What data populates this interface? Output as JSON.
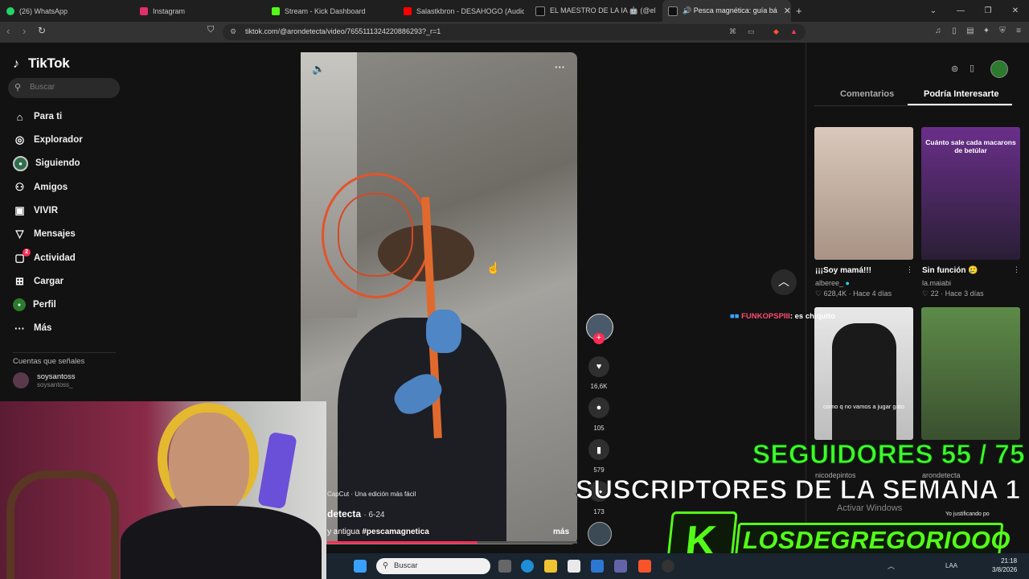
{
  "browser": {
    "tabs": [
      {
        "label": "(26) WhatsApp",
        "color": "#25d366"
      },
      {
        "label": "Instagram",
        "color": "#e1306c"
      },
      {
        "label": "Stream - Kick Dashboard",
        "color": "#53fc18"
      },
      {
        "label": "Salastkbron - DESAHOGO (Audio Ofi",
        "color": "#ff0000"
      },
      {
        "label": "EL MAESTRO DE LA IA 🤖 (@elmaest",
        "color": "#ffffff"
      },
      {
        "label": "🔊 Pesca magnética: guía básica",
        "color": "#ffffff"
      }
    ],
    "new_tab": "+",
    "url": "tiktok.com/@arondetecta/video/7655111324220886293?_r=1"
  },
  "tiktok": {
    "logo": "TikTok",
    "search_placeholder": "Buscar",
    "nav": [
      {
        "label": "Para ti",
        "icon": "home-icon"
      },
      {
        "label": "Explorador",
        "icon": "compass-icon"
      },
      {
        "label": "Siguiendo",
        "icon": "following-icon"
      },
      {
        "label": "Amigos",
        "icon": "friends-icon"
      },
      {
        "label": "VIVIR",
        "icon": "live-icon"
      },
      {
        "label": "Mensajes",
        "icon": "messages-icon"
      },
      {
        "label": "Actividad",
        "icon": "activity-icon",
        "badge": "2"
      },
      {
        "label": "Cargar",
        "icon": "upload-icon"
      },
      {
        "label": "Perfil",
        "icon": "profile-icon"
      },
      {
        "label": "Más",
        "icon": "more-icon"
      }
    ],
    "following_header": "Cuentas que señales",
    "following_account": {
      "name": "soysantoss",
      "handle": "soysantoss_"
    }
  },
  "video": {
    "capcut_line": "CapCut · Una edición más fácil",
    "author": "detecta",
    "date": "· 6-24",
    "description_prefix": "y antigua ",
    "hashtag": "#pescamagnetica",
    "more": "más",
    "progress": 0.6
  },
  "actions": {
    "likes": "16,6K",
    "comments": "105",
    "saves": "579",
    "shares": "173"
  },
  "right_panel": {
    "tab_comments": "Comentarios",
    "tab_interest": "Podría Interesarte",
    "cards": [
      {
        "title": "¡¡¡Soy mamá!!!",
        "author": "alberee_",
        "likes": "628,4K",
        "time": "Hace 4 días",
        "bg": "#b8aca5"
      },
      {
        "title": "Sin función 🥲",
        "author": "la.maiabi",
        "likes": "22",
        "time": "Hace 3 días",
        "bg": "#3a2748",
        "overlay": "Cuánto sale cada macarons de betúlar"
      },
      {
        "title": "",
        "author": "nicodepintos",
        "likes": "",
        "time": "",
        "bg": "#d6d6d6",
        "overlay": "como q no vamos a jugar gato"
      },
      {
        "title": "",
        "author": "arondetecta",
        "likes": "",
        "time": "",
        "bg": "#4f6f3e"
      }
    ]
  },
  "stream_overlay": {
    "chat_user": "FUNKOPSPIII",
    "chat_text": ": es chiquito",
    "followers": "SEGUIDORES 55 / 75",
    "subscribers": "SUSCRIPTORES DE LA SEMANA 1",
    "channel": "LOSDEGREGORIOOO",
    "watermark": "Activar Windows",
    "card_caption": "Yo justificando po"
  },
  "taskbar": {
    "search": "Buscar",
    "lang": "LAA",
    "time": "21:18",
    "date": "3/8/2026"
  }
}
